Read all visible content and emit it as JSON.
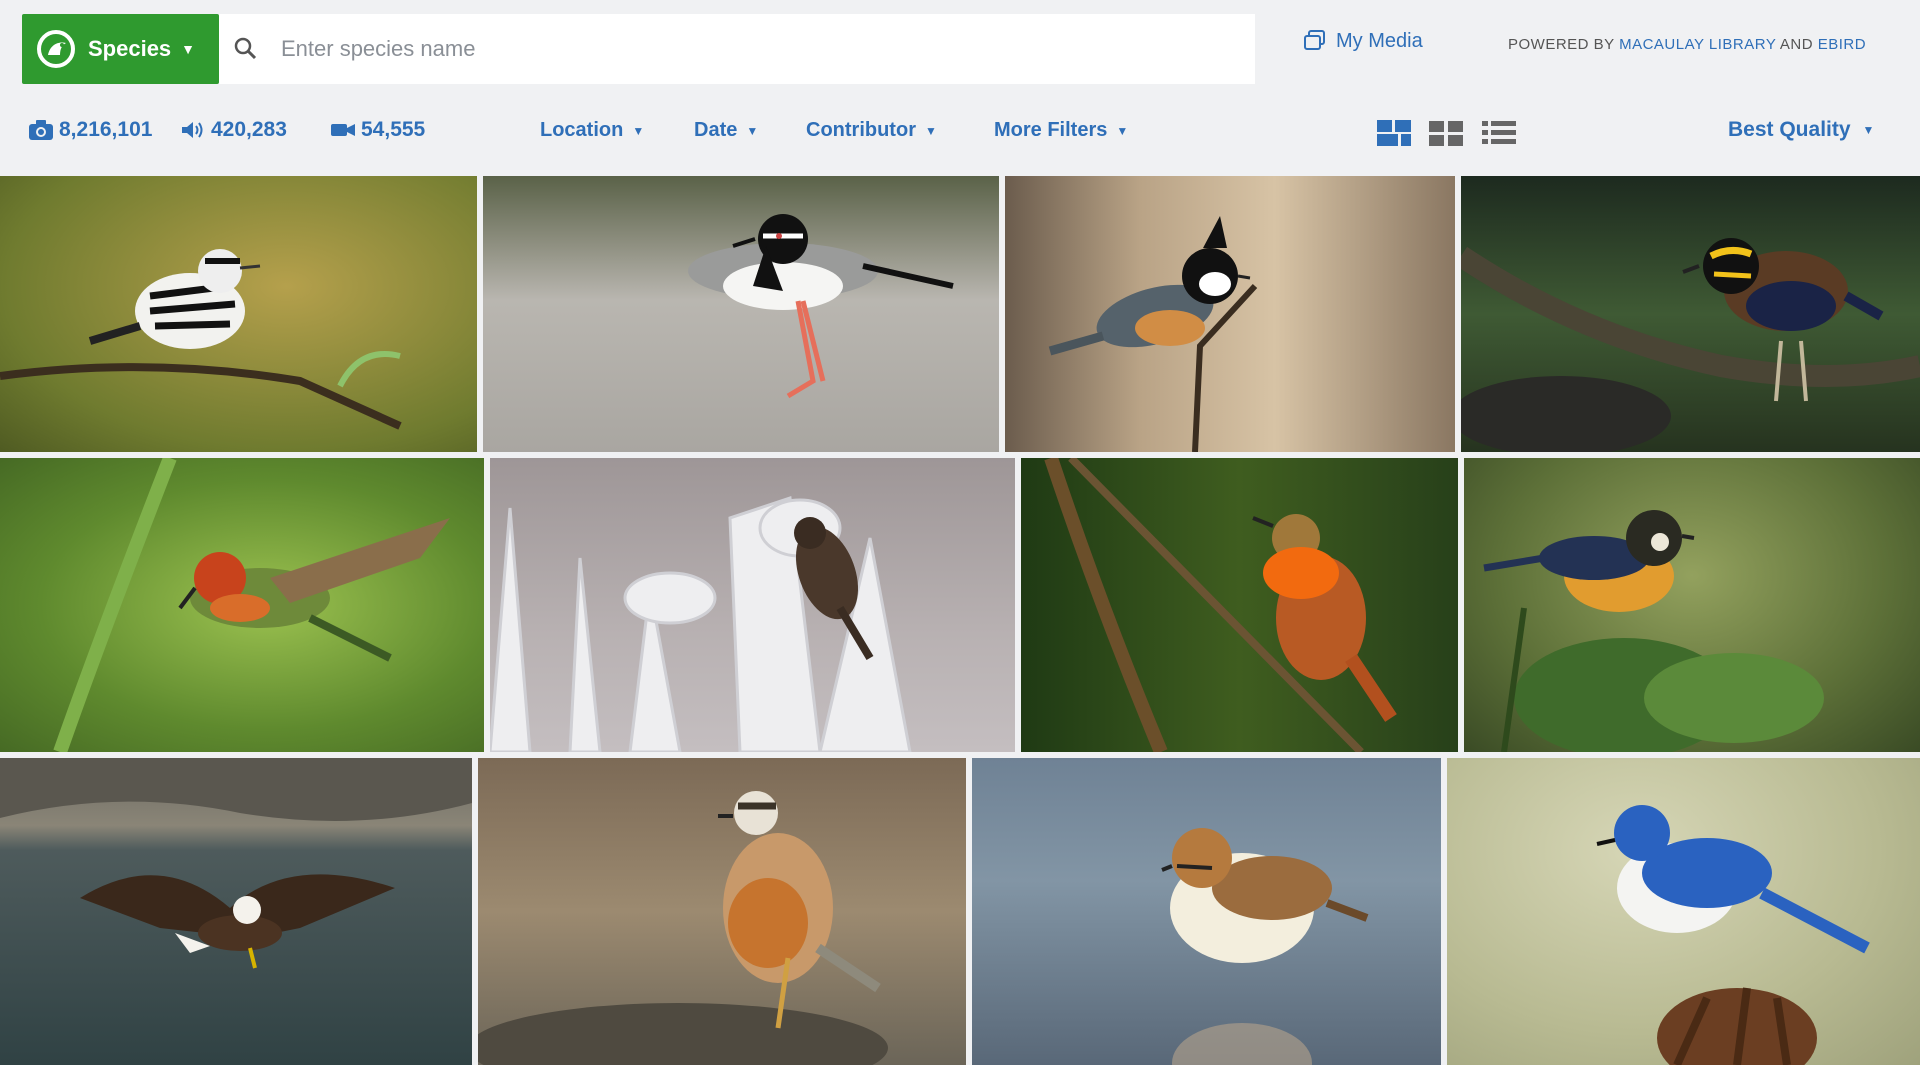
{
  "header": {
    "species_button": {
      "label": "Species",
      "logo": "ebird-logo"
    },
    "search": {
      "placeholder": "Enter species name",
      "value": ""
    },
    "my_media": {
      "label": "My Media",
      "icon": "media-icon"
    },
    "powered_by": {
      "prefix": "POWERED BY",
      "link1": "MACAULAY LIBRARY",
      "and": "AND",
      "link2": "EBIRD"
    }
  },
  "stats": {
    "photos": {
      "icon": "camera-icon",
      "count": "8,216,101"
    },
    "audio": {
      "icon": "speaker-icon",
      "count": "420,283"
    },
    "video": {
      "icon": "video-icon",
      "count": "54,555"
    }
  },
  "filters": {
    "location": "Location",
    "date": "Date",
    "contributor": "Contributor",
    "more": "More Filters"
  },
  "views": [
    "mosaic-view-icon",
    "grid-view-icon",
    "list-view-icon"
  ],
  "sort": {
    "label": "Best Quality"
  },
  "colors": {
    "accent": "#2f6fb8",
    "brand_green": "#2f9a2f",
    "bar_bg": "#f0f1f3"
  },
  "photos": [
    {
      "name": "black-and-white-warbler"
    },
    {
      "name": "pied-plover"
    },
    {
      "name": "tit-on-twig"
    },
    {
      "name": "banded-pitta"
    },
    {
      "name": "tufted-coquette"
    },
    {
      "name": "finch-on-frost"
    },
    {
      "name": "rufous-hummingbird"
    },
    {
      "name": "tanager-on-leaves"
    },
    {
      "name": "bald-eagle"
    },
    {
      "name": "eurasian-dotterel"
    },
    {
      "name": "kentish-plover"
    },
    {
      "name": "blue-flycatcher"
    }
  ]
}
